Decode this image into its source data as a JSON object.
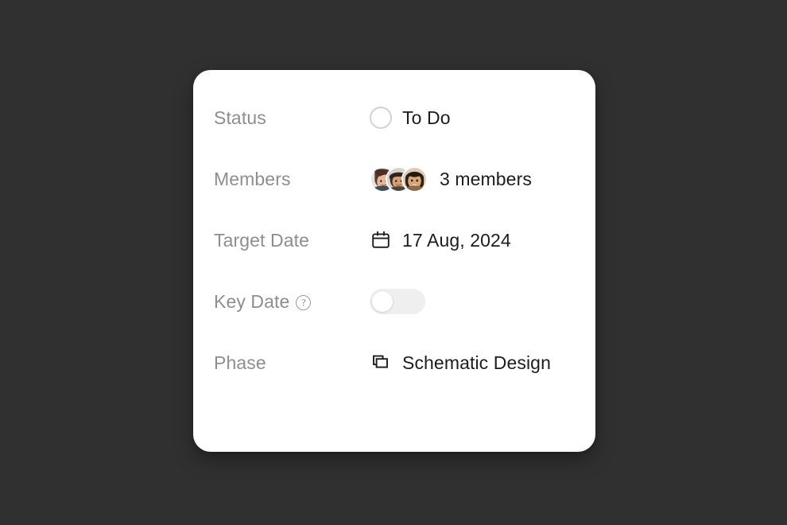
{
  "card": {
    "rows": [
      {
        "label": "Status",
        "value": "To Do",
        "icon": "status-circle-icon",
        "type": "status"
      },
      {
        "label": "Members",
        "value": "3 members",
        "icon": "avatar-group-icon",
        "type": "members",
        "avatar_count": 3
      },
      {
        "label": "Target Date",
        "value": "17 Aug, 2024",
        "icon": "calendar-icon",
        "type": "date"
      },
      {
        "label": "Key Date",
        "value": "",
        "icon": "toggle-switch",
        "type": "toggle",
        "toggle_state": "off",
        "help_icon": "question-mark-icon",
        "help_glyph": "?"
      },
      {
        "label": "Phase",
        "value": "Schematic Design",
        "icon": "layers-icon",
        "type": "phase"
      }
    ]
  },
  "colors": {
    "background": "#303030",
    "card": "#ffffff",
    "label": "#8e8e8e",
    "value": "#1d1d1d",
    "toggle_track": "#efefef",
    "toggle_knob": "#ffffff",
    "status_ring": "#d2d2d2"
  }
}
